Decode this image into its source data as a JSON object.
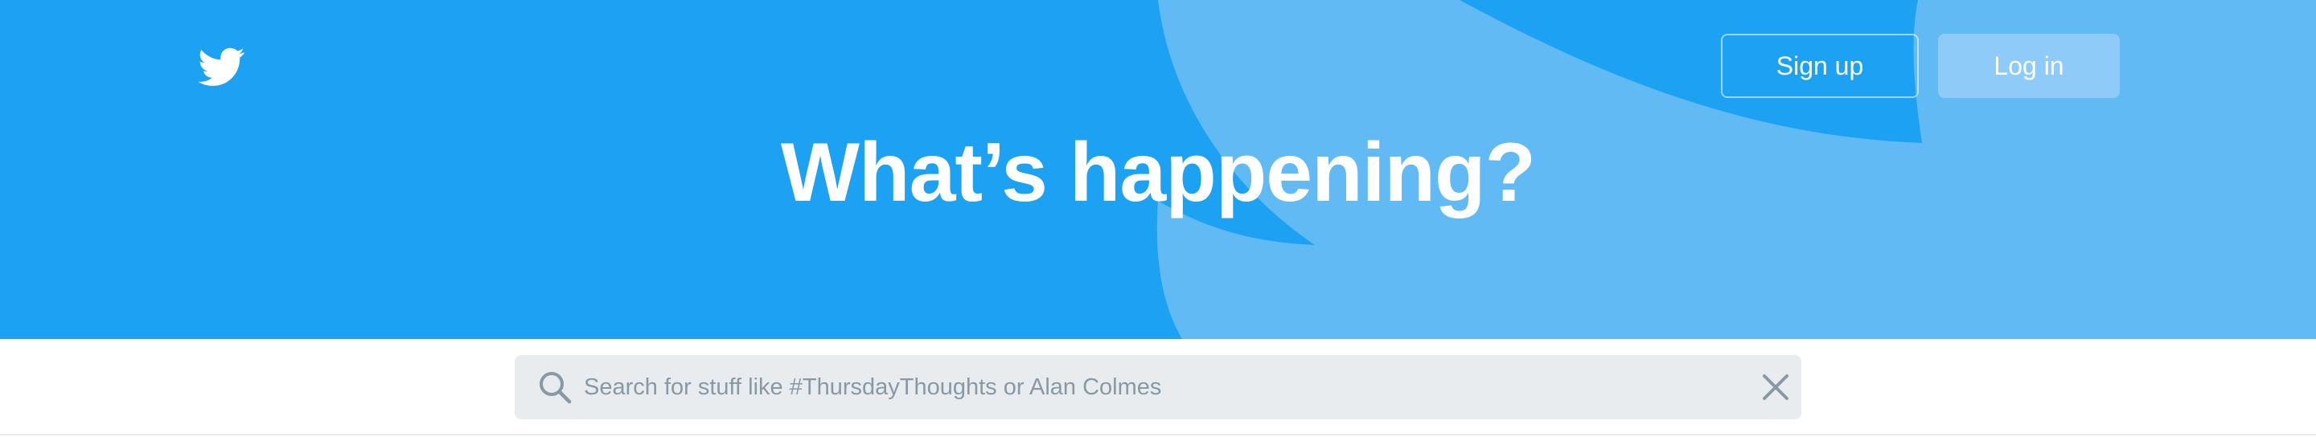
{
  "colors": {
    "brand": "#1da1f2",
    "hero_light": "#62baf4",
    "login_bg": "#8fcbf8",
    "search_bg": "#e8ecef",
    "placeholder": "#8899a6"
  },
  "header": {
    "logo_icon": "twitter-bird-icon",
    "signup_label": "Sign up",
    "login_label": "Log in"
  },
  "hero": {
    "title": "What’s happening?"
  },
  "search": {
    "value": "",
    "placeholder": "Search for stuff like #ThursdayThoughts or Alan Colmes",
    "search_icon": "search-icon",
    "clear_icon": "close-icon"
  }
}
